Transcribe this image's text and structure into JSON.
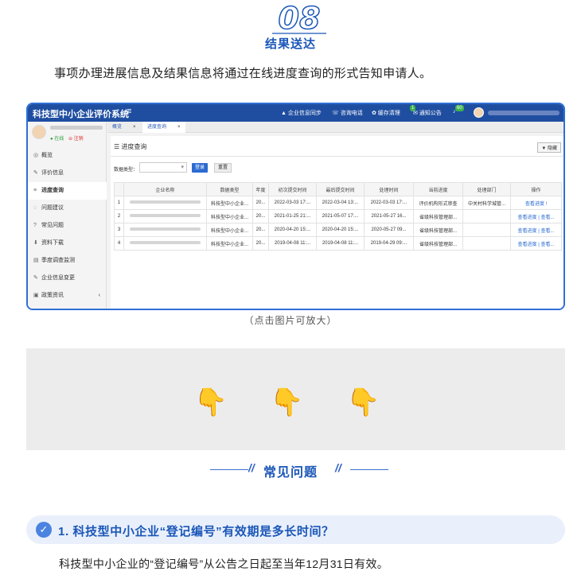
{
  "section": {
    "number": "08",
    "title": "结果送达"
  },
  "intro": "事项办理进展信息及结果信息将通过在线进度查询的形式告知申请人。",
  "screenshot": {
    "app_title": "科技型中小企业评价系统",
    "menu_icon": "menu-icon",
    "topbar": {
      "sync": "▲ 企业信息同步",
      "phone": "☏ 咨询电话",
      "cache": "✿ 缓存清理",
      "notice": "✉ 通知公告",
      "notice_badge": "1",
      "msg_badge": "60"
    },
    "sidebar": {
      "status_online": "● 在线",
      "status_logout": "⊖ 注销",
      "items": [
        {
          "icon": "◎",
          "label": "概览"
        },
        {
          "icon": "✎",
          "label": "评价信息"
        },
        {
          "icon": "≡",
          "label": "进度查询"
        },
        {
          "icon": "◌",
          "label": "问题建议"
        },
        {
          "icon": "?",
          "label": "常见问题"
        },
        {
          "icon": "⬇",
          "label": "资料下载"
        },
        {
          "icon": "▤",
          "label": "季度调查监测"
        },
        {
          "icon": "✎",
          "label": "企业信息变更"
        },
        {
          "icon": "▣",
          "label": "政策资讯"
        }
      ],
      "chevron": "‹"
    },
    "tabs": [
      {
        "label": "概览",
        "close": "×"
      },
      {
        "label": "进度查询",
        "close": "×"
      }
    ],
    "content": {
      "title": "☰ 进度查询",
      "fold_button": "▼ 隐藏",
      "filter_label": "数据类型：",
      "search_button": "登录",
      "reset_button": "重置",
      "columns": [
        "",
        "企业名称",
        "数据类型",
        "年度",
        "初次提交时间",
        "最后提交时间",
        "处理时间",
        "当前进度",
        "处理部门",
        "操作"
      ],
      "rows": [
        {
          "no": "1",
          "type": "科技型中小企业...",
          "year": "20...",
          "first": "2022-03-03 17:...",
          "last": "2022-03-04 13:...",
          "handled": "2022-03-03 17:...",
          "progress": "评价机构形式审查",
          "dept": "中关村科学城管...",
          "ops": "查看进度 !"
        },
        {
          "no": "2",
          "type": "科技型中小企业...",
          "year": "20...",
          "first": "2021-01-25 21:...",
          "last": "2021-05-07 17:...",
          "handled": "2021-05-27 16...",
          "progress": "省级科技管理部...",
          "dept": "",
          "ops": "查看进度 | 查看..."
        },
        {
          "no": "3",
          "type": "科技型中小企业...",
          "year": "20...",
          "first": "2020-04-20 15:...",
          "last": "2020-04-20 15:...",
          "handled": "2020-05-27 09...",
          "progress": "省级科技管理部...",
          "dept": "",
          "ops": "查看进度 | 查看..."
        },
        {
          "no": "4",
          "type": "科技型中小企业...",
          "year": "20...",
          "first": "2019-04-08 11:...",
          "last": "2019-04-08 11:...",
          "handled": "2019-04-29 09:...",
          "progress": "省级科技管理部...",
          "dept": "",
          "ops": "查看进度 | 查看..."
        }
      ]
    }
  },
  "caption": "（点击图片可放大）",
  "hands": "👇 👇 👇",
  "faq": {
    "title": "常见问题",
    "slash": "//",
    "question": "1. 科技型中小企业“登记编号”有效期是多长时间？",
    "check_icon": "✓",
    "answer": "科技型中小企业的“登记编号”从公告之日起至当年12月31日有效。"
  },
  "colors": {
    "accent": "#1b56b8",
    "topbar": "#1f4ea1",
    "frame": "#2f6fd6",
    "pill": "#e9f0fb"
  }
}
